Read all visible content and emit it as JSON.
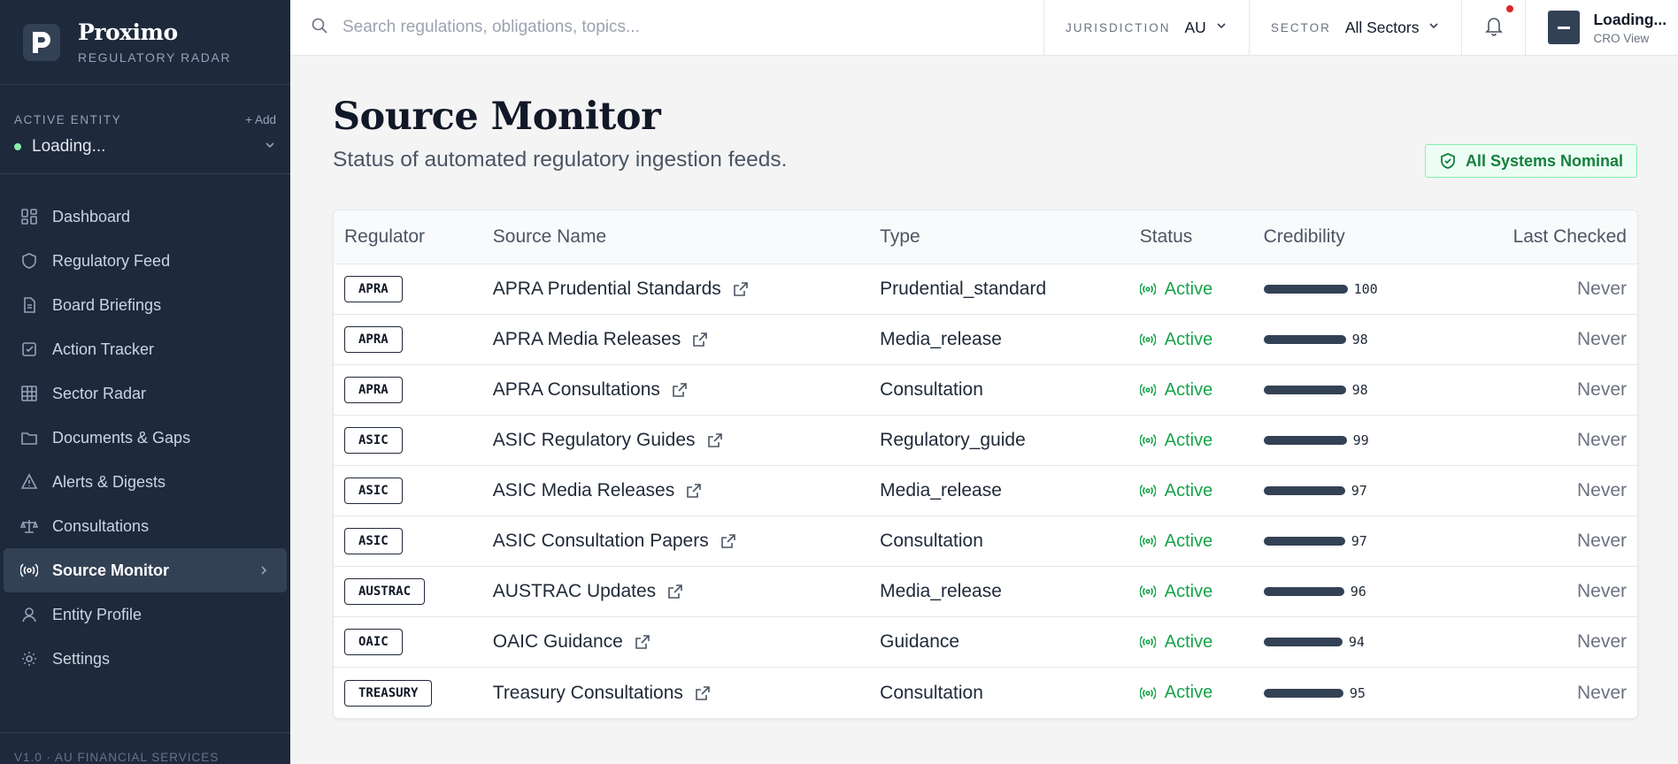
{
  "brand": {
    "name": "Proximo",
    "subtitle": "REGULATORY RADAR"
  },
  "entity": {
    "label": "ACTIVE ENTITY",
    "add": "+ Add",
    "value": "Loading..."
  },
  "nav": [
    {
      "label": "Dashboard",
      "icon": "dashboard-icon"
    },
    {
      "label": "Regulatory Feed",
      "icon": "shield-icon"
    },
    {
      "label": "Board Briefings",
      "icon": "document-icon"
    },
    {
      "label": "Action Tracker",
      "icon": "checkbox-icon"
    },
    {
      "label": "Sector Radar",
      "icon": "grid-icon"
    },
    {
      "label": "Documents & Gaps",
      "icon": "folder-icon"
    },
    {
      "label": "Alerts & Digests",
      "icon": "alert-icon"
    },
    {
      "label": "Consultations",
      "icon": "scale-icon"
    },
    {
      "label": "Source Monitor",
      "icon": "radio-icon",
      "active": true
    },
    {
      "label": "Entity Profile",
      "icon": "user-icon"
    },
    {
      "label": "Settings",
      "icon": "gear-icon"
    }
  ],
  "footer": "V1.0 · AU FINANCIAL SERVICES",
  "search": {
    "placeholder": "Search regulations, obligations, topics..."
  },
  "filters": {
    "jurisdiction": {
      "label": "JURISDICTION",
      "value": "AU"
    },
    "sector": {
      "label": "SECTOR",
      "value": "All Sectors"
    }
  },
  "user": {
    "name": "Loading...",
    "role": "CRO View"
  },
  "page": {
    "title": "Source Monitor",
    "subtitle": "Status of automated regulatory ingestion feeds.",
    "status_badge": "All Systems Nominal"
  },
  "table": {
    "headers": [
      "Regulator",
      "Source Name",
      "Type",
      "Status",
      "Credibility",
      "Last Checked"
    ],
    "rows": [
      {
        "regulator": "APRA",
        "source": "APRA Prudential Standards",
        "type": "Prudential_standard",
        "status": "Active",
        "credibility": 100,
        "last_checked": "Never"
      },
      {
        "regulator": "APRA",
        "source": "APRA Media Releases",
        "type": "Media_release",
        "status": "Active",
        "credibility": 98,
        "last_checked": "Never"
      },
      {
        "regulator": "APRA",
        "source": "APRA Consultations",
        "type": "Consultation",
        "status": "Active",
        "credibility": 98,
        "last_checked": "Never"
      },
      {
        "regulator": "ASIC",
        "source": "ASIC Regulatory Guides",
        "type": "Regulatory_guide",
        "status": "Active",
        "credibility": 99,
        "last_checked": "Never"
      },
      {
        "regulator": "ASIC",
        "source": "ASIC Media Releases",
        "type": "Media_release",
        "status": "Active",
        "credibility": 97,
        "last_checked": "Never"
      },
      {
        "regulator": "ASIC",
        "source": "ASIC Consultation Papers",
        "type": "Consultation",
        "status": "Active",
        "credibility": 97,
        "last_checked": "Never"
      },
      {
        "regulator": "AUSTRAC",
        "source": "AUSTRAC Updates",
        "type": "Media_release",
        "status": "Active",
        "credibility": 96,
        "last_checked": "Never"
      },
      {
        "regulator": "OAIC",
        "source": "OAIC Guidance",
        "type": "Guidance",
        "status": "Active",
        "credibility": 94,
        "last_checked": "Never"
      },
      {
        "regulator": "TREASURY",
        "source": "Treasury Consultations",
        "type": "Consultation",
        "status": "Active",
        "credibility": 95,
        "last_checked": "Never"
      }
    ]
  },
  "colors": {
    "sidebar": "#1e293b",
    "accent": "#334155",
    "success": "#16a34a",
    "alert": "#dc2626"
  }
}
